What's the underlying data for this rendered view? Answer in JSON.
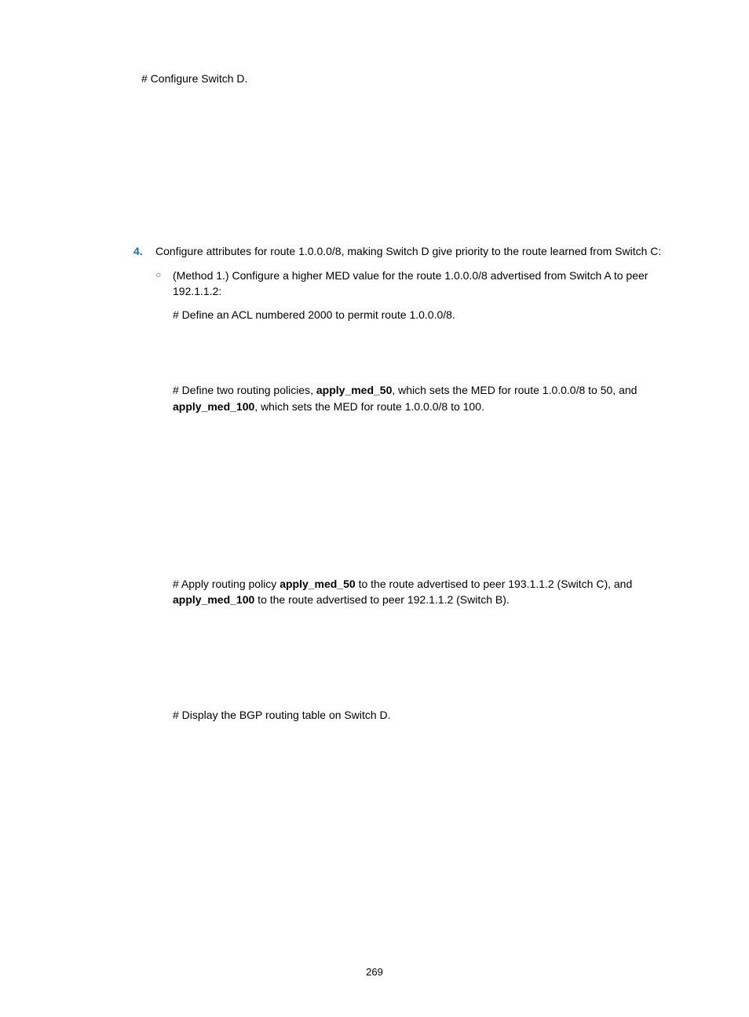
{
  "top_instruction": "# Configure Switch D.",
  "step": {
    "number": "4.",
    "text": "Configure attributes for route 1.0.0.0/8, making Switch D give priority to the route learned from Switch C:"
  },
  "sub": {
    "marker": "○",
    "text": "(Method 1.) Configure a higher MED value for the route 1.0.0.0/8 advertised from Switch A to peer 192.1.1.2:"
  },
  "instr1": "# Define an ACL numbered 2000 to permit route 1.0.0.0/8.",
  "instr2_pre": "# Define two routing policies, ",
  "instr2_b1": "apply_med_50",
  "instr2_mid1": ", which sets the MED for route 1.0.0.0/8 to 50, and ",
  "instr2_b2": "apply_med_100",
  "instr2_post": ", which sets the MED for route 1.0.0.0/8 to 100.",
  "instr3_pre": "# Apply routing policy ",
  "instr3_b1": "apply_med_50",
  "instr3_mid1": " to the route advertised to peer 193.1.1.2 (Switch C), and ",
  "instr3_b2": "apply_med_100",
  "instr3_post": " to the route advertised to peer 192.1.1.2 (Switch B).",
  "instr4": "# Display the BGP routing table on Switch D.",
  "page_number": "269"
}
